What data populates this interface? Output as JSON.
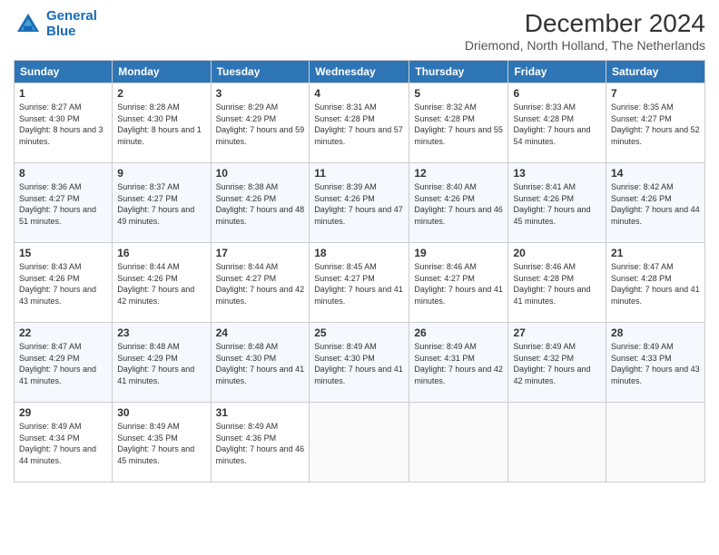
{
  "logo": {
    "line1": "General",
    "line2": "Blue"
  },
  "title": "December 2024",
  "subtitle": "Driemond, North Holland, The Netherlands",
  "days_header": [
    "Sunday",
    "Monday",
    "Tuesday",
    "Wednesday",
    "Thursday",
    "Friday",
    "Saturday"
  ],
  "weeks": [
    [
      {
        "day": "1",
        "sunrise": "8:27 AM",
        "sunset": "4:30 PM",
        "daylight": "8 hours and 3 minutes."
      },
      {
        "day": "2",
        "sunrise": "8:28 AM",
        "sunset": "4:30 PM",
        "daylight": "8 hours and 1 minute."
      },
      {
        "day": "3",
        "sunrise": "8:29 AM",
        "sunset": "4:29 PM",
        "daylight": "7 hours and 59 minutes."
      },
      {
        "day": "4",
        "sunrise": "8:31 AM",
        "sunset": "4:28 PM",
        "daylight": "7 hours and 57 minutes."
      },
      {
        "day": "5",
        "sunrise": "8:32 AM",
        "sunset": "4:28 PM",
        "daylight": "7 hours and 55 minutes."
      },
      {
        "day": "6",
        "sunrise": "8:33 AM",
        "sunset": "4:28 PM",
        "daylight": "7 hours and 54 minutes."
      },
      {
        "day": "7",
        "sunrise": "8:35 AM",
        "sunset": "4:27 PM",
        "daylight": "7 hours and 52 minutes."
      }
    ],
    [
      {
        "day": "8",
        "sunrise": "8:36 AM",
        "sunset": "4:27 PM",
        "daylight": "7 hours and 51 minutes."
      },
      {
        "day": "9",
        "sunrise": "8:37 AM",
        "sunset": "4:27 PM",
        "daylight": "7 hours and 49 minutes."
      },
      {
        "day": "10",
        "sunrise": "8:38 AM",
        "sunset": "4:26 PM",
        "daylight": "7 hours and 48 minutes."
      },
      {
        "day": "11",
        "sunrise": "8:39 AM",
        "sunset": "4:26 PM",
        "daylight": "7 hours and 47 minutes."
      },
      {
        "day": "12",
        "sunrise": "8:40 AM",
        "sunset": "4:26 PM",
        "daylight": "7 hours and 46 minutes."
      },
      {
        "day": "13",
        "sunrise": "8:41 AM",
        "sunset": "4:26 PM",
        "daylight": "7 hours and 45 minutes."
      },
      {
        "day": "14",
        "sunrise": "8:42 AM",
        "sunset": "4:26 PM",
        "daylight": "7 hours and 44 minutes."
      }
    ],
    [
      {
        "day": "15",
        "sunrise": "8:43 AM",
        "sunset": "4:26 PM",
        "daylight": "7 hours and 43 minutes."
      },
      {
        "day": "16",
        "sunrise": "8:44 AM",
        "sunset": "4:26 PM",
        "daylight": "7 hours and 42 minutes."
      },
      {
        "day": "17",
        "sunrise": "8:44 AM",
        "sunset": "4:27 PM",
        "daylight": "7 hours and 42 minutes."
      },
      {
        "day": "18",
        "sunrise": "8:45 AM",
        "sunset": "4:27 PM",
        "daylight": "7 hours and 41 minutes."
      },
      {
        "day": "19",
        "sunrise": "8:46 AM",
        "sunset": "4:27 PM",
        "daylight": "7 hours and 41 minutes."
      },
      {
        "day": "20",
        "sunrise": "8:46 AM",
        "sunset": "4:28 PM",
        "daylight": "7 hours and 41 minutes."
      },
      {
        "day": "21",
        "sunrise": "8:47 AM",
        "sunset": "4:28 PM",
        "daylight": "7 hours and 41 minutes."
      }
    ],
    [
      {
        "day": "22",
        "sunrise": "8:47 AM",
        "sunset": "4:29 PM",
        "daylight": "7 hours and 41 minutes."
      },
      {
        "day": "23",
        "sunrise": "8:48 AM",
        "sunset": "4:29 PM",
        "daylight": "7 hours and 41 minutes."
      },
      {
        "day": "24",
        "sunrise": "8:48 AM",
        "sunset": "4:30 PM",
        "daylight": "7 hours and 41 minutes."
      },
      {
        "day": "25",
        "sunrise": "8:49 AM",
        "sunset": "4:30 PM",
        "daylight": "7 hours and 41 minutes."
      },
      {
        "day": "26",
        "sunrise": "8:49 AM",
        "sunset": "4:31 PM",
        "daylight": "7 hours and 42 minutes."
      },
      {
        "day": "27",
        "sunrise": "8:49 AM",
        "sunset": "4:32 PM",
        "daylight": "7 hours and 42 minutes."
      },
      {
        "day": "28",
        "sunrise": "8:49 AM",
        "sunset": "4:33 PM",
        "daylight": "7 hours and 43 minutes."
      }
    ],
    [
      {
        "day": "29",
        "sunrise": "8:49 AM",
        "sunset": "4:34 PM",
        "daylight": "7 hours and 44 minutes."
      },
      {
        "day": "30",
        "sunrise": "8:49 AM",
        "sunset": "4:35 PM",
        "daylight": "7 hours and 45 minutes."
      },
      {
        "day": "31",
        "sunrise": "8:49 AM",
        "sunset": "4:36 PM",
        "daylight": "7 hours and 46 minutes."
      },
      null,
      null,
      null,
      null
    ]
  ]
}
